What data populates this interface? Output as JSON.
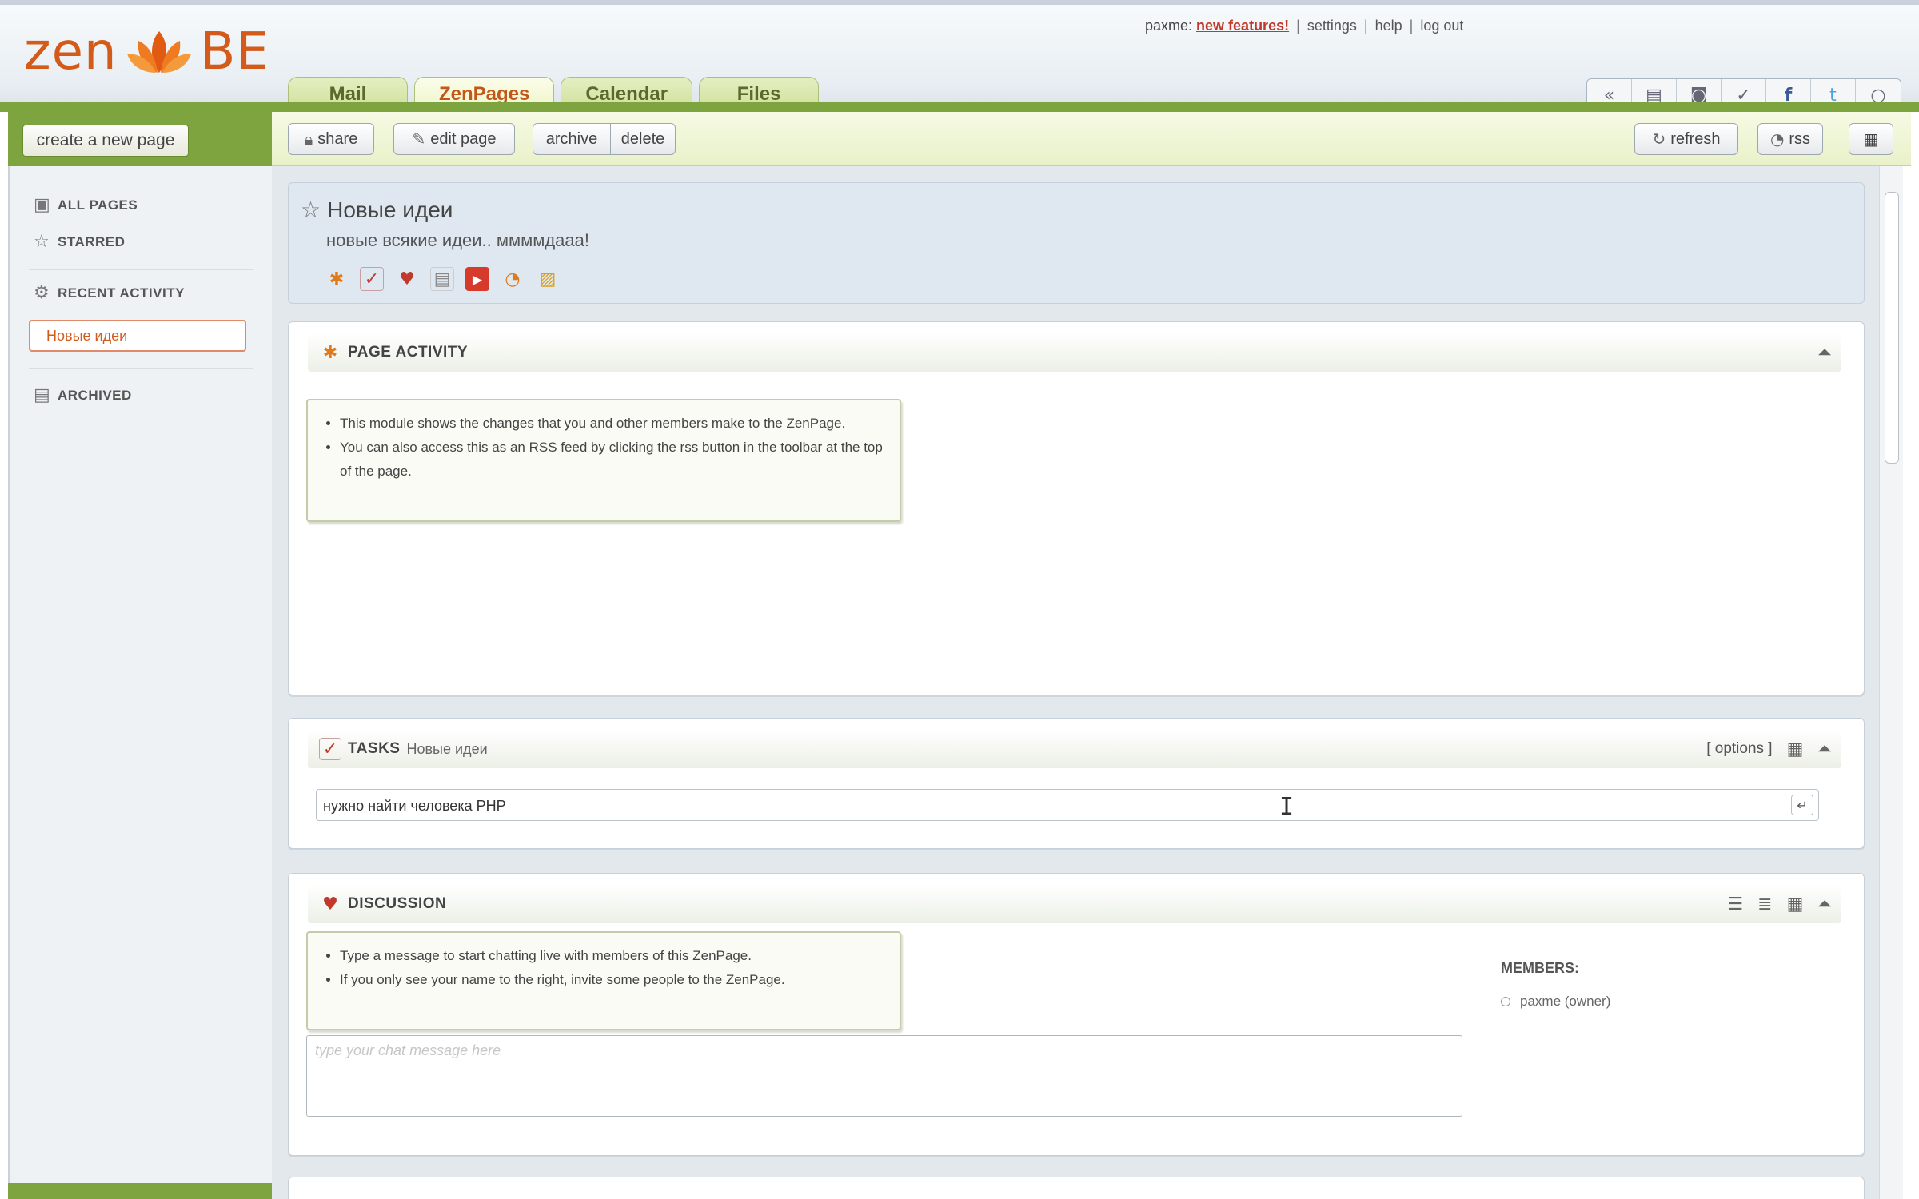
{
  "app": {
    "logo_part1": "zen",
    "logo_part2": "BE",
    "accent_color": "#d45a1a",
    "brand_green": "#7ea43f"
  },
  "top_links": {
    "user": "paxme:",
    "new_features": "new features!",
    "settings": "settings",
    "help": "help",
    "logout": "log out",
    "separator": "|"
  },
  "tabs": [
    {
      "label": "Mail",
      "active": false
    },
    {
      "label": "ZenPages",
      "active": true
    },
    {
      "label": "Calendar",
      "active": false
    },
    {
      "label": "Files",
      "active": false
    }
  ],
  "right_icons": [
    "back-icon",
    "page-icon",
    "contact-icon",
    "check-icon",
    "facebook-icon",
    "twitter-icon",
    "chat-bubble-icon"
  ],
  "toolbar": {
    "create_label": "create a new page",
    "share_label": "share",
    "edit_label": "edit page",
    "archive_label": "archive",
    "delete_label": "delete",
    "refresh_label": "refresh",
    "rss_label": "rss"
  },
  "sidebar": {
    "all_pages": "ALL PAGES",
    "starred": "STARRED",
    "recent_activity": "RECENT ACTIVITY",
    "active_page": "Новые идеи",
    "archived": "ARCHIVED"
  },
  "page": {
    "title": "Новые идеи",
    "subtitle": "новые всякие идеи.. ммммдааа!",
    "module_icons": [
      "activity-icon",
      "tasks-icon",
      "discussion-icon",
      "notes-icon",
      "youtube-icon",
      "rss-icon",
      "photos-icon"
    ]
  },
  "activity": {
    "title": "PAGE ACTIVITY",
    "help": [
      "This module shows the changes that you and other members make to the ZenPage.",
      "You can also access this as an RSS feed by clicking the rss button in the toolbar at the top of the page."
    ]
  },
  "tasks": {
    "title": "TASKS",
    "subtitle": "Новые идеи",
    "options": "[ options ]",
    "input_value": "нужно найти человека PHP"
  },
  "discussion": {
    "title": "DISCUSSION",
    "help": [
      "Type a message to start chatting live with members of this ZenPage.",
      "If you only see your name to the right, invite some people to the ZenPage."
    ],
    "chat_placeholder": "type your chat message here",
    "members_title": "MEMBERS:",
    "member": "paxme (owner)"
  }
}
